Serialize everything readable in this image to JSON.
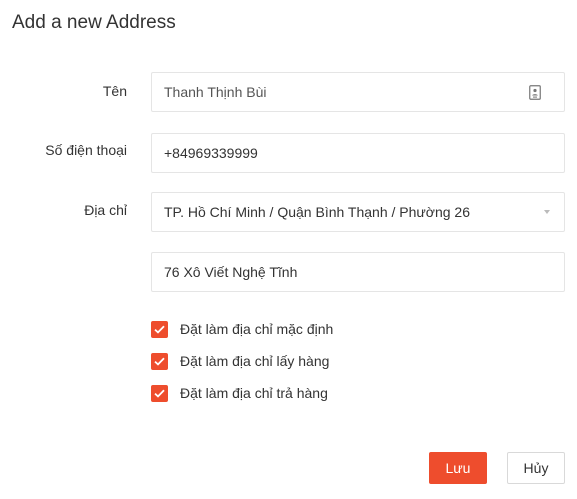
{
  "dialog": {
    "title": "Add a new Address"
  },
  "form": {
    "name": {
      "label": "Tên",
      "value": "Thanh Thịnh Bùi",
      "icon": "contact-card-icon"
    },
    "phone": {
      "label": "Số điện thoại",
      "value": "+84969339999"
    },
    "address": {
      "label": "Địa chỉ",
      "region_value": "TP. Hồ Chí Minh / Quận Bình Thạnh / Phường 26",
      "region_icon": "caret-down-icon",
      "street_value": "76 Xô Viết Nghệ Tĩnh"
    },
    "checkboxes": [
      {
        "label": "Đặt làm địa chỉ mặc định",
        "checked": true
      },
      {
        "label": "Đặt làm địa chỉ lấy hàng",
        "checked": true
      },
      {
        "label": "Đặt làm địa chỉ trả hàng",
        "checked": true
      }
    ]
  },
  "actions": {
    "save_label": "Lưu",
    "cancel_label": "Hủy"
  },
  "colors": {
    "accent": "#ee4d2d",
    "border": "#e5e5e5",
    "text": "#333333"
  }
}
